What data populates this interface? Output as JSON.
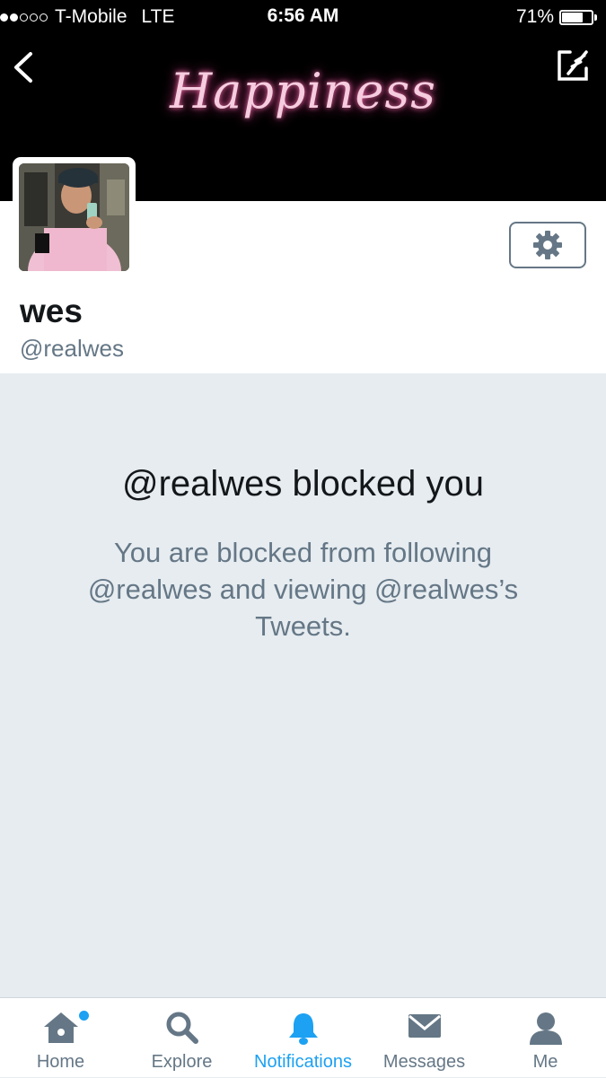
{
  "status_bar": {
    "carrier": "T-Mobile",
    "network": "LTE",
    "time": "6:56 AM",
    "battery_percent": "71%",
    "battery_level": 0.71,
    "signal_bars_filled": 2,
    "signal_bars_total": 5
  },
  "header": {
    "banner_text": "Happiness",
    "back_icon": "chevron-left-icon",
    "compose_icon": "compose-icon"
  },
  "profile": {
    "name": "wes",
    "handle": "@realwes",
    "settings_icon": "gear-icon"
  },
  "blocked": {
    "title": "@realwes blocked you",
    "message": "You are blocked from following @realwes and viewing @realwes’s Tweets."
  },
  "tab_bar": {
    "home": "Home",
    "explore": "Explore",
    "notifications": "Notifications",
    "messages": "Messages",
    "me": "Me"
  },
  "colors": {
    "accent": "#1da1f2",
    "muted_text": "#657786",
    "background": "#e6ecf0",
    "banner_glow": "#e96aa5"
  }
}
